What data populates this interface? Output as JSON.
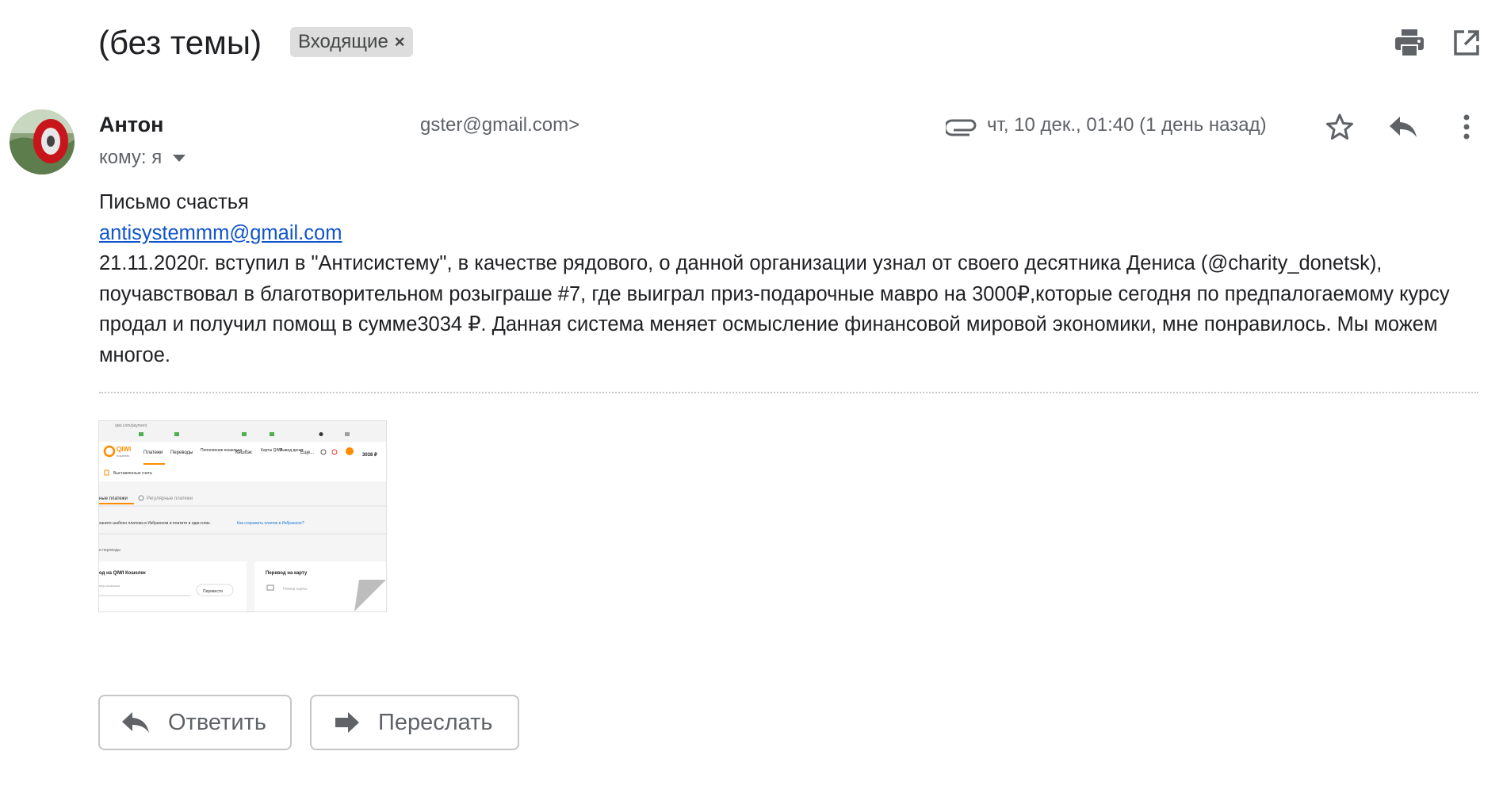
{
  "header": {
    "subject": "(без темы)",
    "label": "Входящие",
    "label_remove": "×",
    "print_icon": "print-icon",
    "open_new_window_icon": "open-in-new-icon"
  },
  "message": {
    "sender_name": "Антон",
    "sender_email": "gster@gmail.com>",
    "to_label": "кому: я",
    "date": "чт, 10 дек., 01:40 (1 день назад)",
    "attachment_icon": "paperclip-icon",
    "star_icon": "star-icon",
    "reply_icon": "reply-icon",
    "more_icon": "more-vert-icon",
    "body": {
      "line1": "Письмо счастья",
      "link": "antisystemmm@gmail.com",
      "paragraph": "21.11.2020г. вступил в \"Антисистему\", в качестве рядового, о данной организации узнал от своего десятника Дениса (@charity_donetsk), поучавствовал в благотворительном розыграше #7, где выиграл приз-подарочные мавро на 3000₽,которые сегодня по предпалогаемому курсу продал и получил помощ в сумме3034 ₽. Данная система меняет осмысление финансовой мировой экономики, мне понравилось. Мы можем многое."
    }
  },
  "attachment": {
    "url_bar": "qiwi.com/payment",
    "logo": "QIWI",
    "logo_sub": "Кошелек",
    "nav": [
      "Платежи",
      "Переводы",
      "Пополнение кошелька",
      "Кешбэк",
      "Карты QIWI",
      "Вывод денег",
      "Еще..."
    ],
    "balance": "3038 ₽",
    "invoices": "Выставленные счета",
    "tab_active": "ные платежи",
    "tab_regular": "Регулярные платежи",
    "hint": "ханите шаблон платежа в Избранном и платите в один клик.",
    "hint_link": "Как сохранить платеж в Избранное?",
    "section": "и переводы",
    "card1_title": "од на QIWI Кошелек",
    "card1_field": "мер кошелька",
    "card1_button": "Перевести",
    "card2_title": "Перевод на карту",
    "card2_field": "Номер карты"
  },
  "actions": {
    "reply": "Ответить",
    "forward": "Переслать"
  },
  "colors": {
    "link": "#1155cc",
    "label_chip": "#dddddd",
    "qiwi_orange": "#ff8c00"
  }
}
